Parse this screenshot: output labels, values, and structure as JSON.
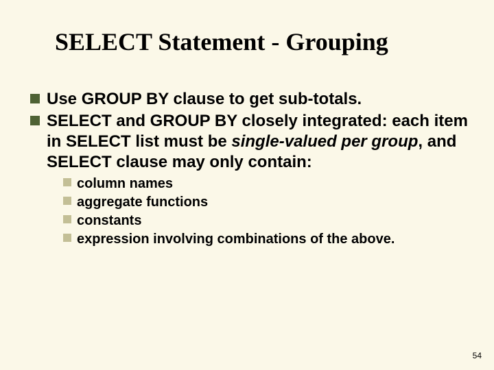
{
  "title": "SELECT Statement - Grouping",
  "bullets": [
    {
      "text": "Use GROUP BY clause to get sub-totals."
    },
    {
      "prefix": "SELECT and GROUP BY closely integrated: each item in SELECT list must be ",
      "italic": "single-valued per group",
      "suffix": ", and SELECT clause may only contain:"
    }
  ],
  "subbullets": [
    "column names",
    "aggregate functions",
    "constants",
    "expression involving combinations of the above."
  ],
  "page_number": "54"
}
